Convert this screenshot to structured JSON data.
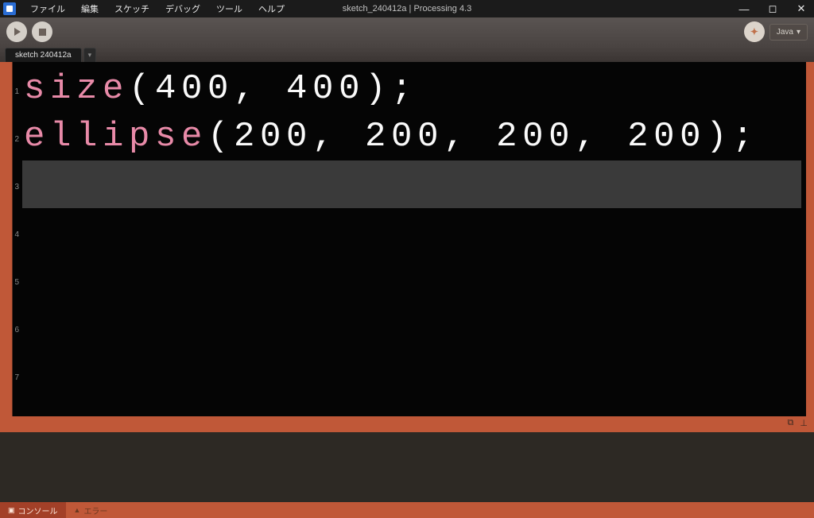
{
  "menubar": {
    "items": [
      "ファイル",
      "編集",
      "スケッチ",
      "デバッグ",
      "ツール",
      "ヘルプ"
    ]
  },
  "window": {
    "title": "sketch_240412a | Processing 4.3"
  },
  "toolbar": {
    "mode": "Java"
  },
  "tabs": {
    "active": "sketch 240412a"
  },
  "editor": {
    "lines": [
      {
        "num": "1",
        "keyword": "size",
        "rest": "(400, 400);"
      },
      {
        "num": "2",
        "keyword": "ellipse",
        "rest": "(200, 200, 200, 200);"
      },
      {
        "num": "3",
        "keyword": "",
        "rest": ""
      },
      {
        "num": "4",
        "keyword": "",
        "rest": ""
      },
      {
        "num": "5",
        "keyword": "",
        "rest": ""
      },
      {
        "num": "6",
        "keyword": "",
        "rest": ""
      },
      {
        "num": "7",
        "keyword": "",
        "rest": ""
      }
    ]
  },
  "bottomTabs": {
    "console": "コンソール",
    "errors": "エラー"
  }
}
